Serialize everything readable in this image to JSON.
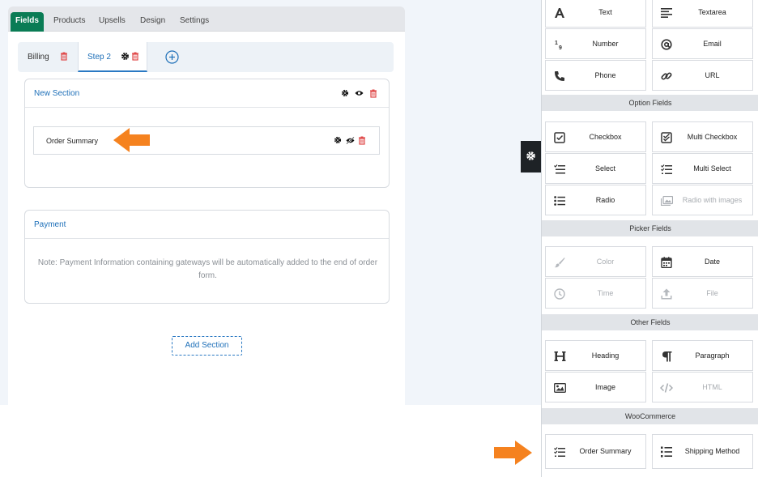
{
  "tabs": [
    {
      "label": "Fields",
      "active": true
    },
    {
      "label": "Products"
    },
    {
      "label": "Upsells"
    },
    {
      "label": "Design"
    },
    {
      "label": "Settings"
    }
  ],
  "steps": [
    {
      "label": "Billing"
    },
    {
      "label": "Step 2",
      "active": true
    }
  ],
  "sections": [
    {
      "title": "New Section",
      "fields": [
        {
          "label": "Order Summary"
        }
      ]
    },
    {
      "title": "Payment",
      "note": "Note: Payment Information containing gateways will be automatically added to the end of order form."
    }
  ],
  "add_section_label": "Add Section",
  "sidebar": {
    "basic": [
      {
        "label": "Text",
        "icon": "text-icon"
      },
      {
        "label": "Textarea",
        "icon": "textarea-icon"
      },
      {
        "label": "Number",
        "icon": "number-icon"
      },
      {
        "label": "Email",
        "icon": "at-icon"
      },
      {
        "label": "Phone",
        "icon": "phone-icon"
      },
      {
        "label": "URL",
        "icon": "link-icon"
      }
    ],
    "option_title": "Option Fields",
    "option": [
      {
        "label": "Checkbox",
        "icon": "checkbox-icon"
      },
      {
        "label": "Multi Checkbox",
        "icon": "multi-checkbox-icon"
      },
      {
        "label": "Select",
        "icon": "select-icon"
      },
      {
        "label": "Multi Select",
        "icon": "multi-select-icon"
      },
      {
        "label": "Radio",
        "icon": "radio-icon"
      },
      {
        "label": "Radio with images",
        "icon": "image-icon",
        "disabled": true
      }
    ],
    "picker_title": "Picker Fields",
    "picker": [
      {
        "label": "Color",
        "icon": "brush-icon",
        "disabled": true
      },
      {
        "label": "Date",
        "icon": "calendar-icon"
      },
      {
        "label": "Time",
        "icon": "clock-icon",
        "disabled": true
      },
      {
        "label": "File",
        "icon": "upload-icon",
        "disabled": true
      }
    ],
    "other_title": "Other Fields",
    "other": [
      {
        "label": "Heading",
        "icon": "heading-icon"
      },
      {
        "label": "Paragraph",
        "icon": "paragraph-icon"
      },
      {
        "label": "Image",
        "icon": "image-icon"
      },
      {
        "label": "HTML",
        "icon": "code-icon",
        "disabled": true
      }
    ],
    "woo_title": "WooCommerce",
    "woo": [
      {
        "label": "Order Summary",
        "icon": "order-list-icon"
      },
      {
        "label": "Shipping Method",
        "icon": "list-icon"
      }
    ]
  },
  "colors": {
    "accent": "#1d6fb8",
    "tab_active": "#0a7c55",
    "arrow": "#f5821f",
    "delete": "#e04848"
  }
}
